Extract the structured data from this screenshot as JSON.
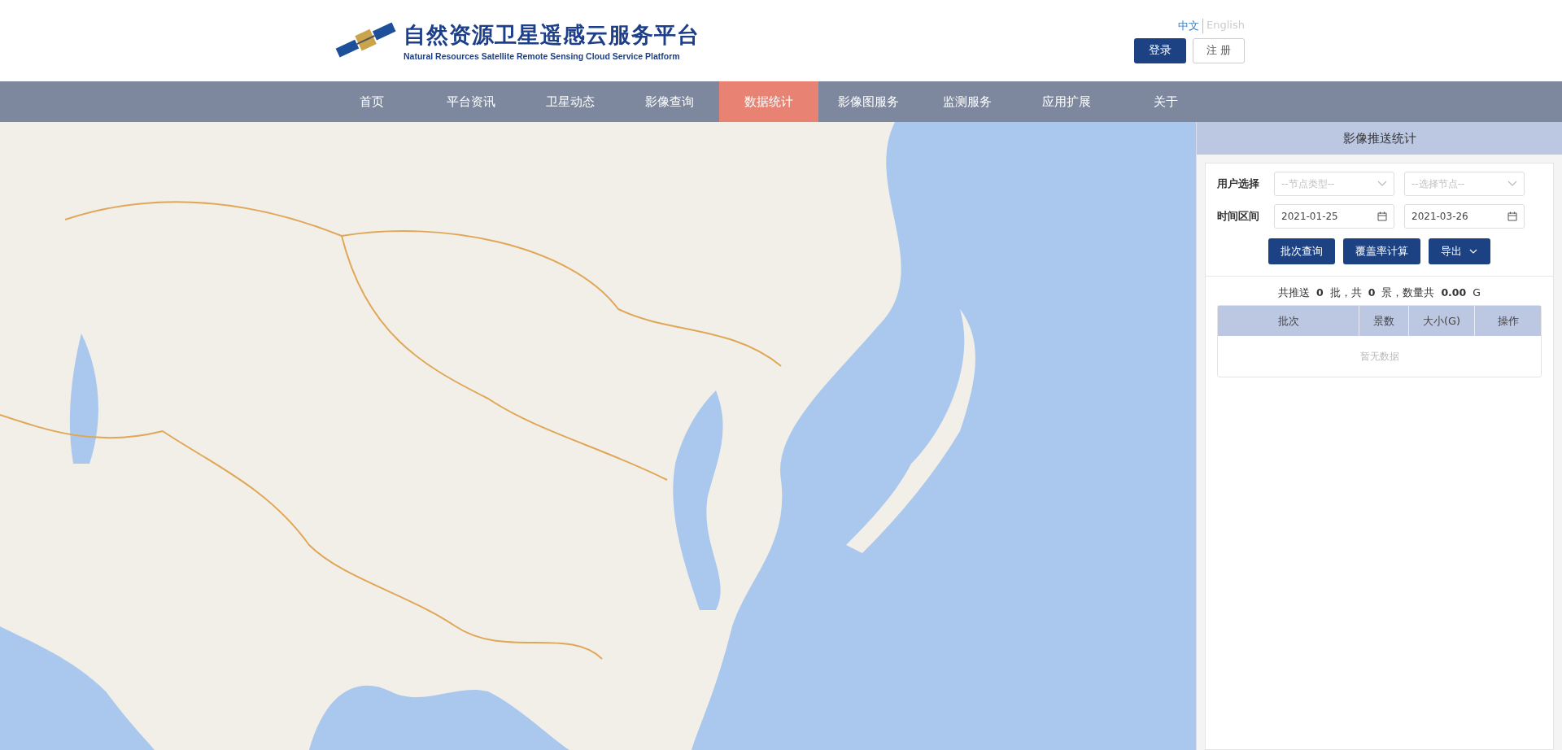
{
  "header": {
    "title": "自然资源卫星遥感云服务平台",
    "subtitle": "Natural Resources Satellite Remote Sensing Cloud Service Platform",
    "languages": [
      {
        "label": "中文",
        "selected": true
      },
      {
        "label": "English",
        "selected": false
      }
    ],
    "login": "登录",
    "register": "注 册"
  },
  "nav": [
    {
      "label": "首页",
      "selected": false
    },
    {
      "label": "平台资讯",
      "selected": false
    },
    {
      "label": "卫星动态",
      "selected": false
    },
    {
      "label": "影像查询",
      "selected": false
    },
    {
      "label": "数据统计",
      "selected": true
    },
    {
      "label": "影像图服务",
      "selected": false
    },
    {
      "label": "监测服务",
      "selected": false
    },
    {
      "label": "应用扩展",
      "selected": false
    },
    {
      "label": "关于",
      "selected": false
    }
  ],
  "panel": {
    "title": "影像推送统计",
    "user_label": "用户选择",
    "node_type": {
      "placeholder": "--节点类型--"
    },
    "node": {
      "placeholder": "--选择节点--"
    },
    "time_label": "时间区间",
    "start_date": "2021-01-25",
    "end_date": "2021-03-26",
    "buttons": [
      {
        "label": "批次查询",
        "kind": "plain"
      },
      {
        "label": "覆盖率计算",
        "kind": "plain"
      },
      {
        "label": "导出",
        "kind": "dropdown"
      }
    ],
    "summary": "共推送 **0** 批，共 **0** 景，数量共 **0.00** G",
    "table": {
      "columns": [
        "批次",
        "景数",
        "大小(G)",
        "操作"
      ],
      "empty": "暂无数据"
    }
  }
}
